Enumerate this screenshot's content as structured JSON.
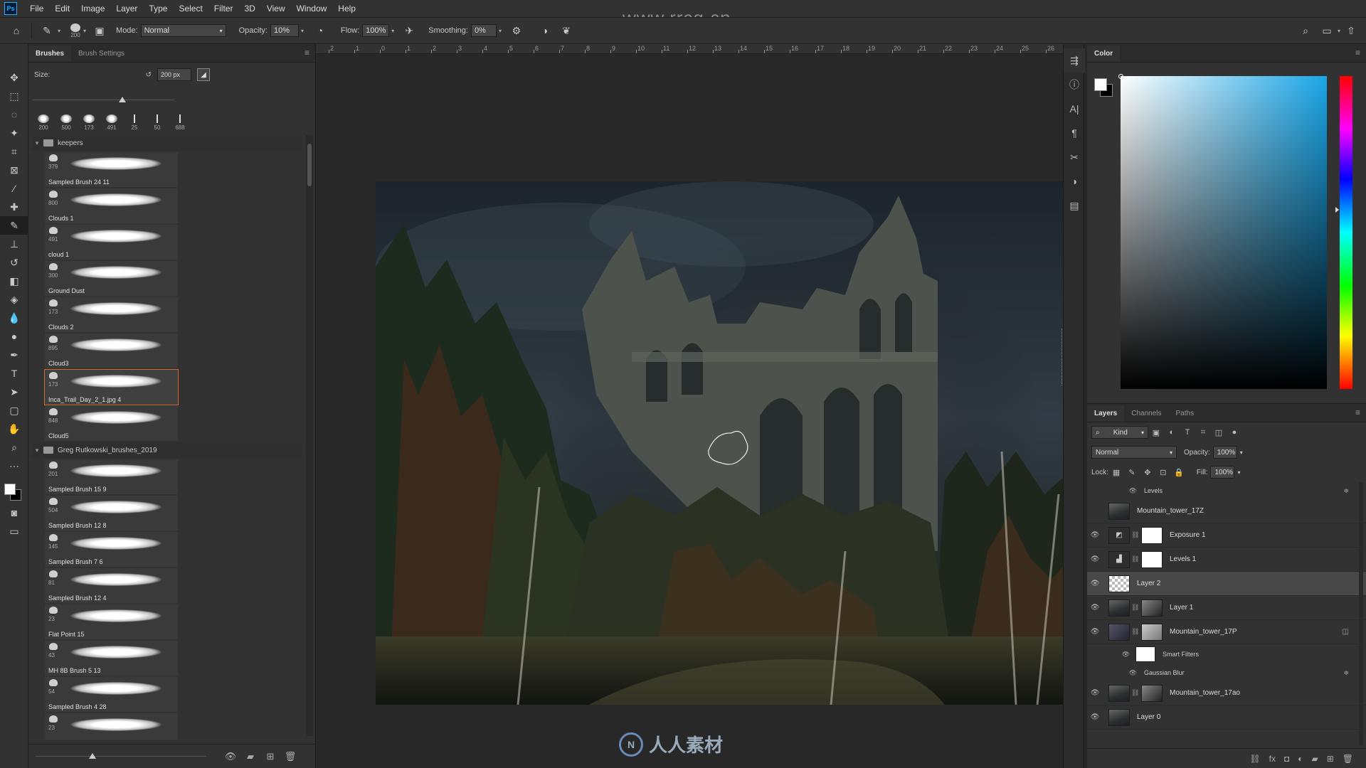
{
  "menubar": {
    "logo": "Ps",
    "items": [
      "File",
      "Edit",
      "Image",
      "Layer",
      "Type",
      "Select",
      "Filter",
      "3D",
      "View",
      "Window",
      "Help"
    ],
    "watermark": "www.rrcg.cn"
  },
  "options": {
    "brush_size": "200",
    "mode_label": "Mode:",
    "mode_value": "Normal",
    "opacity_label": "Opacity:",
    "opacity_value": "10%",
    "flow_label": "Flow:",
    "flow_value": "100%",
    "smoothing_label": "Smoothing:",
    "smoothing_value": "0%"
  },
  "tools": [
    "move-tool",
    "marquee-tool",
    "lasso-tool",
    "magic-wand-tool",
    "crop-tool",
    "frame-tool",
    "eyedropper-tool",
    "healing-brush-tool",
    "brush-tool",
    "clone-stamp-tool",
    "history-brush-tool",
    "eraser-tool",
    "paint-bucket-tool",
    "blur-tool",
    "dodge-tool",
    "pen-tool",
    "type-tool",
    "path-selection-tool",
    "shape-tool",
    "hand-tool",
    "zoom-tool",
    "more-tools"
  ],
  "brushes_panel": {
    "tabs": [
      "Brushes",
      "Brush Settings"
    ],
    "size_label": "Size:",
    "size_value": "200 px",
    "presets": [
      "200",
      "500",
      "173",
      "491",
      "25",
      "50",
      "688"
    ],
    "groups": [
      {
        "name": "keepers",
        "brushes": [
          {
            "size": "379",
            "name": "Sampled Brush 24 11"
          },
          {
            "size": "800",
            "name": "Clouds 1"
          },
          {
            "size": "491",
            "name": "cloud 1"
          },
          {
            "size": "300",
            "name": "Ground Dust"
          },
          {
            "size": "173",
            "name": "Clouds 2"
          },
          {
            "size": "895",
            "name": "Cloud3"
          },
          {
            "size": "173",
            "name": "Inca_Trail_Day_2_1.jpg 4"
          },
          {
            "size": "848",
            "name": "Cloud5"
          }
        ]
      },
      {
        "name": "Greg Rutkowski_brushes_2019",
        "brushes": [
          {
            "size": "201",
            "name": "Sampled Brush 15 9"
          },
          {
            "size": "504",
            "name": "Sampled Brush 12 8"
          },
          {
            "size": "145",
            "name": "Sampled Brush 7 6"
          },
          {
            "size": "81",
            "name": "Sampled Brush 12 4"
          },
          {
            "size": "23",
            "name": "Flat Point 15"
          },
          {
            "size": "43",
            "name": "MH 8B Brush 5 13"
          },
          {
            "size": "54",
            "name": "Sampled Brush 4 28"
          },
          {
            "size": "23",
            "name": ""
          }
        ]
      }
    ],
    "selected_brush": "Inca_Trail_Day_2_1.jpg 4"
  },
  "ruler": [
    "2",
    "1",
    "0",
    "1",
    "2",
    "3",
    "4",
    "5",
    "6",
    "7",
    "8",
    "9",
    "10",
    "11",
    "12",
    "13",
    "14",
    "15",
    "16",
    "17",
    "18",
    "19",
    "20",
    "21",
    "22",
    "23",
    "24",
    "25",
    "26"
  ],
  "color_panel": {
    "title": "Color"
  },
  "layers_panel": {
    "tabs": [
      "Layers",
      "Channels",
      "Paths"
    ],
    "kind_label": "Kind",
    "blend_mode": "Normal",
    "opacity_label": "Opacity:",
    "opacity_value": "100%",
    "lock_label": "Lock:",
    "fill_label": "Fill:",
    "fill_value": "100%",
    "layers": [
      {
        "name": "Levels",
        "visible": false,
        "type": "effect-header"
      },
      {
        "name": "Mountain_tower_17Z",
        "visible": false,
        "type": "image"
      },
      {
        "name": "Exposure 1",
        "visible": true,
        "type": "adjustment"
      },
      {
        "name": "Levels 1",
        "visible": true,
        "type": "adjustment"
      },
      {
        "name": "Layer 2",
        "visible": true,
        "type": "transparent",
        "active": true
      },
      {
        "name": "Layer 1",
        "visible": true,
        "type": "image"
      },
      {
        "name": "Mountain_tower_17P",
        "visible": true,
        "type": "smart-object"
      },
      {
        "name": "Smart Filters",
        "visible": true,
        "type": "smart-filters"
      },
      {
        "name": "Gaussian Blur",
        "visible": true,
        "type": "filter"
      },
      {
        "name": "Mountain_tower_17ao",
        "visible": true,
        "type": "image"
      },
      {
        "name": "Layer 0",
        "visible": true,
        "type": "image"
      }
    ]
  },
  "watermarks": {
    "bottom_logo_text": "人人素材",
    "bottom_logo_mark": "N"
  }
}
